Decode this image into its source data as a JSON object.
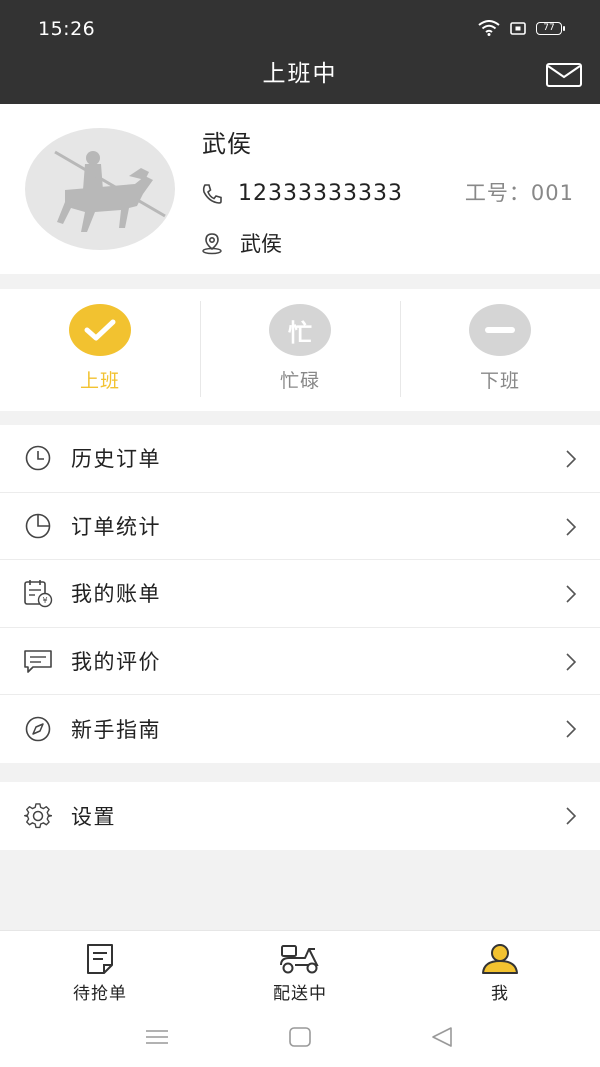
{
  "status_bar": {
    "time": "15:26",
    "battery": "77"
  },
  "header": {
    "title": "上班中",
    "mail_icon": "mail-icon"
  },
  "profile": {
    "name": "武侯",
    "phone": "12333333333",
    "employee_id_label": "工号：001",
    "address": "武侯"
  },
  "work_status": [
    {
      "label": "上班",
      "glyph": "✔",
      "active": true,
      "color": "#f2c230"
    },
    {
      "label": "忙碌",
      "glyph": "忙",
      "active": false,
      "color": "#d5d5d5"
    },
    {
      "label": "下班",
      "glyph": "—",
      "active": false,
      "color": "#d5d5d5"
    }
  ],
  "menu": [
    {
      "label": "历史订单",
      "icon": "clock-icon"
    },
    {
      "label": "订单统计",
      "icon": "pie-chart-icon"
    },
    {
      "label": "我的账单",
      "icon": "bill-icon"
    },
    {
      "label": "我的评价",
      "icon": "comment-icon"
    },
    {
      "label": "新手指南",
      "icon": "compass-icon"
    }
  ],
  "settings": {
    "label": "设置",
    "icon": "gear-icon"
  },
  "tabs": [
    {
      "label": "待抢单",
      "icon": "document-icon",
      "active": false
    },
    {
      "label": "配送中",
      "icon": "scooter-icon",
      "active": false
    },
    {
      "label": "我",
      "icon": "user-icon",
      "active": true
    }
  ],
  "colors": {
    "header_bg": "#333333",
    "accent": "#f2c230",
    "inactive": "#d5d5d5",
    "text": "#222222"
  }
}
